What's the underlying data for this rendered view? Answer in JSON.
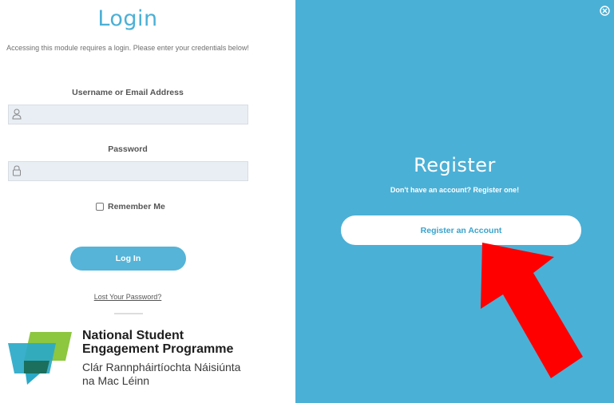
{
  "login": {
    "title": "Login",
    "description": "Accessing this module requires a login. Please enter your credentials below!",
    "username_label": "Username or Email Address",
    "username_value": "",
    "password_label": "Password",
    "password_value": "",
    "remember_label": "Remember Me",
    "remember_checked": false,
    "login_button": "Log In",
    "lost_password_link": "Lost Your Password?"
  },
  "logo": {
    "title_line1": "National Student",
    "title_line2": "Engagement Programme",
    "subtitle_line1": "Clár Rannpháirtíochta Náisiúnta",
    "subtitle_line2": "na Mac Léinn"
  },
  "register": {
    "title": "Register",
    "description": "Don't have an account? Register one!",
    "button": "Register an Account"
  },
  "colors": {
    "accent": "#4bb0d6",
    "button": "#55b4d8",
    "arrow": "#ff0000",
    "logo_green": "#8dc63f",
    "logo_teal": "#2aa9c8"
  },
  "icons": {
    "username": "user-icon",
    "password": "lock-icon",
    "close": "close-icon",
    "annotation": "red-arrow-icon"
  }
}
